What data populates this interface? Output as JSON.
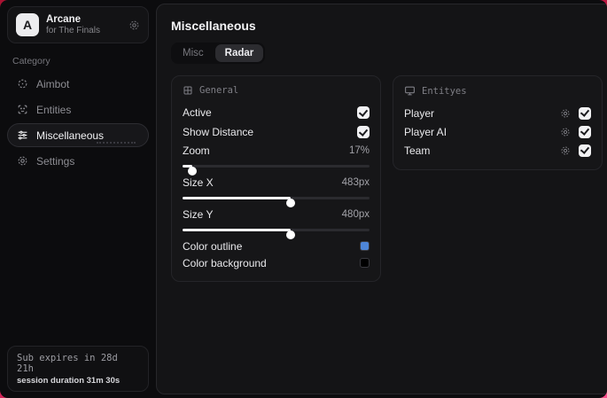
{
  "brand": {
    "logo_letter": "A",
    "title": "Arcane",
    "subtitle": "for The Finals"
  },
  "colors": {
    "backdrop": "#c81a4a",
    "outline_swatch": "#4e86d8",
    "background_swatch": "#000000"
  },
  "sidebar": {
    "category_label": "Category",
    "items": [
      {
        "label": "Aimbot",
        "icon": "crosshair-icon",
        "active": false
      },
      {
        "label": "Entities",
        "icon": "scan-face-icon",
        "active": false
      },
      {
        "label": "Miscellaneous",
        "icon": "sliders-icon",
        "active": true
      },
      {
        "label": "Settings",
        "icon": "gear-icon",
        "active": false
      }
    ],
    "subscription": {
      "line1": "Sub expires in 28d 21h",
      "line2": "session duration 31m 30s"
    }
  },
  "main": {
    "title": "Miscellaneous",
    "tabs": [
      {
        "label": "Misc",
        "active": false
      },
      {
        "label": "Radar",
        "active": true
      }
    ],
    "general_panel": {
      "title": "General",
      "active": {
        "label": "Active",
        "checked": true
      },
      "show_distance": {
        "label": "Show Distance",
        "checked": true
      },
      "zoom": {
        "label": "Zoom",
        "value": "17%",
        "fill_pct": 5
      },
      "size_x": {
        "label": "Size X",
        "value": "483px",
        "fill_pct": 58
      },
      "size_y": {
        "label": "Size Y",
        "value": "480px",
        "fill_pct": 58
      },
      "color_outline": {
        "label": "Color outline",
        "color": "#4e86d8"
      },
      "color_background": {
        "label": "Color background",
        "color": "#000000"
      }
    },
    "entities_panel": {
      "title": "Entityes",
      "rows": [
        {
          "label": "Player",
          "checked": true
        },
        {
          "label": "Player AI",
          "checked": true
        },
        {
          "label": "Team",
          "checked": true
        }
      ]
    }
  }
}
